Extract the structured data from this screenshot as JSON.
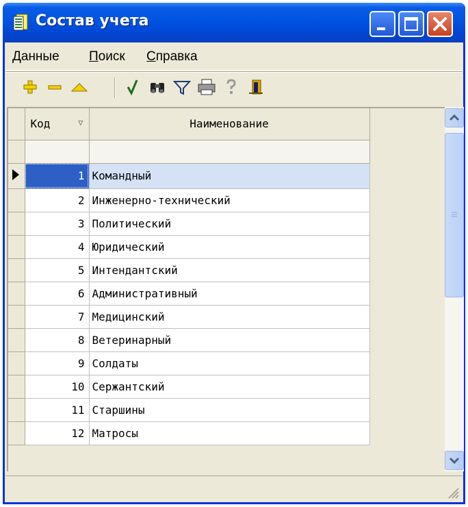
{
  "window": {
    "title": "Состав учета"
  },
  "menu": {
    "items": [
      {
        "mnemonic": "Д",
        "rest": "анные"
      },
      {
        "mnemonic": "П",
        "rest": "оиск"
      },
      {
        "mnemonic": "С",
        "rest": "правка"
      }
    ]
  },
  "toolbar": {
    "icons": [
      "add-icon",
      "delete-icon",
      "edit-icon",
      "checkmark-icon",
      "binoculars-icon",
      "filter-icon",
      "print-icon",
      "help-icon",
      "exit-icon"
    ]
  },
  "grid": {
    "headers": {
      "code": "Код",
      "name": "Наименование"
    },
    "rows": [
      {
        "code": "1",
        "name": "Командный"
      },
      {
        "code": "2",
        "name": "Инженерно-технический"
      },
      {
        "code": "3",
        "name": "Политический"
      },
      {
        "code": "4",
        "name": "Юридический"
      },
      {
        "code": "5",
        "name": "Интендантский"
      },
      {
        "code": "6",
        "name": "Административный"
      },
      {
        "code": "7",
        "name": "Медицинский"
      },
      {
        "code": "8",
        "name": "Ветеринарный"
      },
      {
        "code": "9",
        "name": "Солдаты"
      },
      {
        "code": "10",
        "name": "Сержантский"
      },
      {
        "code": "11",
        "name": "Старшины"
      },
      {
        "code": "12",
        "name": "Матросы"
      }
    ],
    "selected_row": 1
  },
  "colors": {
    "titlebar": "#0054E3",
    "selection": "#2D5FC7",
    "window_bg": "#ECE9D8"
  }
}
